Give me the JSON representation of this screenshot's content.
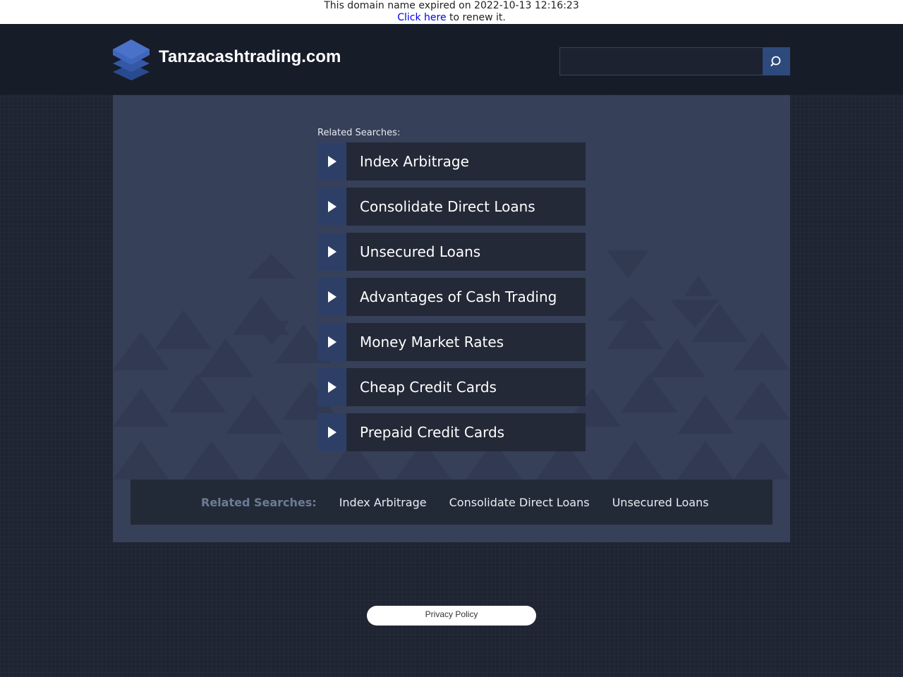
{
  "expiry_notice": {
    "message": "This domain name expired on 2022-10-13 12:16:23",
    "renew_link": "Click here",
    "renew_suffix": " to renew it."
  },
  "header": {
    "site_title": "Tanzacashtrading.com",
    "logo_icon": "stacked-layers-icon",
    "search": {
      "placeholder": "",
      "value": "",
      "button_icon": "search-icon"
    }
  },
  "main": {
    "related_label": "Related Searches:",
    "links": [
      {
        "label": "Index Arbitrage",
        "icon": "play-arrow-icon"
      },
      {
        "label": "Consolidate Direct Loans",
        "icon": "play-arrow-icon"
      },
      {
        "label": "Unsecured Loans",
        "icon": "play-arrow-icon"
      },
      {
        "label": "Advantages of Cash Trading",
        "icon": "play-arrow-icon"
      },
      {
        "label": "Money Market Rates",
        "icon": "play-arrow-icon"
      },
      {
        "label": "Cheap Credit Cards",
        "icon": "play-arrow-icon"
      },
      {
        "label": "Prepaid Credit Cards",
        "icon": "play-arrow-icon"
      }
    ]
  },
  "bottom_bar": {
    "label": "Related Searches:",
    "links": [
      "Index Arbitrage",
      "Consolidate Direct Loans",
      "Unsecured Loans"
    ]
  },
  "footer": {
    "privacy_label": "Privacy Policy"
  },
  "colors": {
    "page_bg": "#1f2433",
    "header_bg": "#171c29",
    "panel_bg": "#374059",
    "link_bg": "#232936",
    "arrow_bg": "#2e3f67",
    "search_button_bg": "#2e4a7d",
    "bottom_label": "#6c7c96"
  }
}
